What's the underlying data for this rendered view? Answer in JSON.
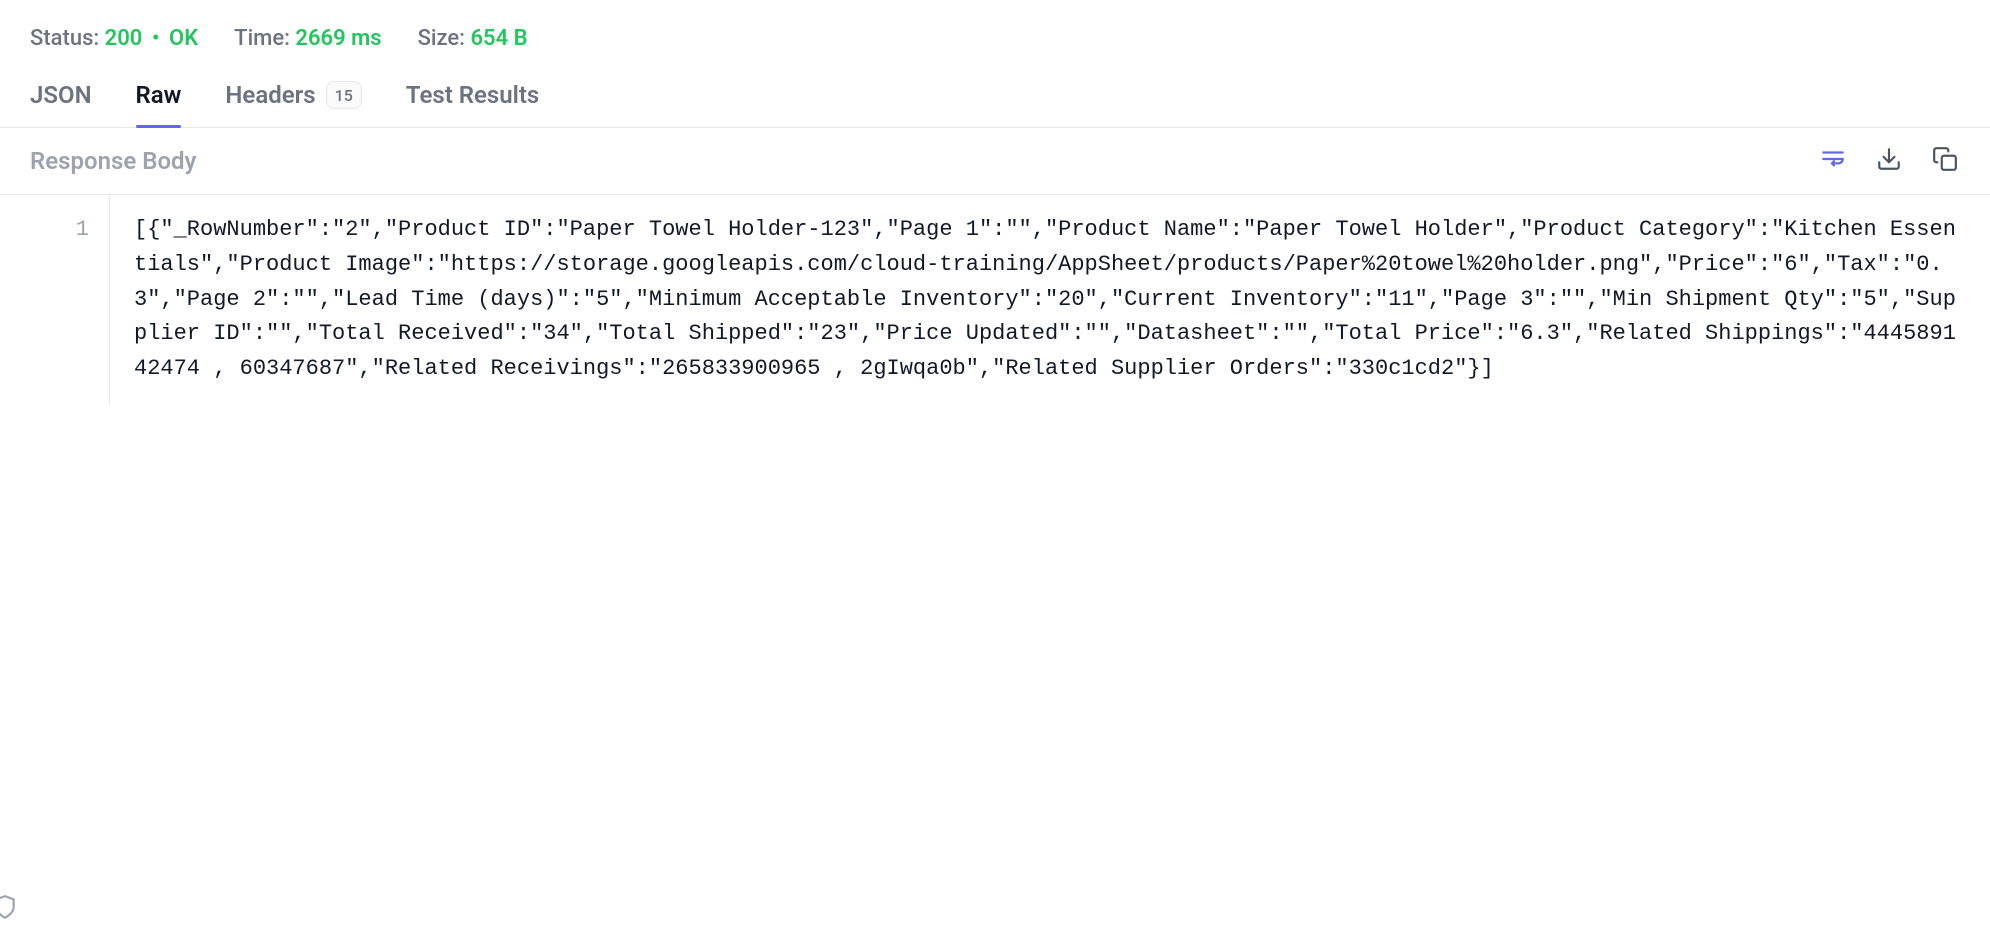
{
  "status_bar": {
    "status_label": "Status:",
    "status_code": "200",
    "status_text": "OK",
    "time_label": "Time:",
    "time_value": "2669 ms",
    "size_label": "Size:",
    "size_value": "654 B"
  },
  "tabs": {
    "json": "JSON",
    "raw": "Raw",
    "headers": "Headers",
    "headers_count": "15",
    "test_results": "Test Results"
  },
  "body_header": {
    "title": "Response Body"
  },
  "code": {
    "line_number": "1",
    "content": "[{\"_RowNumber\":\"2\",\"Product ID\":\"Paper Towel Holder-123\",\"Page 1\":\"\",\"Product Name\":\"Paper Towel Holder\",\"Product Category\":\"Kitchen Essentials\",\"Product Image\":\"https://storage.googleapis.com/cloud-training/AppSheet/products/Paper%20towel%20holder.png\",\"Price\":\"6\",\"Tax\":\"0.3\",\"Page 2\":\"\",\"Lead Time (days)\":\"5\",\"Minimum Acceptable Inventory\":\"20\",\"Current Inventory\":\"11\",\"Page 3\":\"\",\"Min Shipment Qty\":\"5\",\"Supplier ID\":\"\",\"Total Received\":\"34\",\"Total Shipped\":\"23\",\"Price Updated\":\"\",\"Datasheet\":\"\",\"Total Price\":\"6.3\",\"Related Shippings\":\"444589142474 , 60347687\",\"Related Receivings\":\"265833900965 , 2gIwqa0b\",\"Related Supplier Orders\":\"330c1cd2\"}]"
  }
}
